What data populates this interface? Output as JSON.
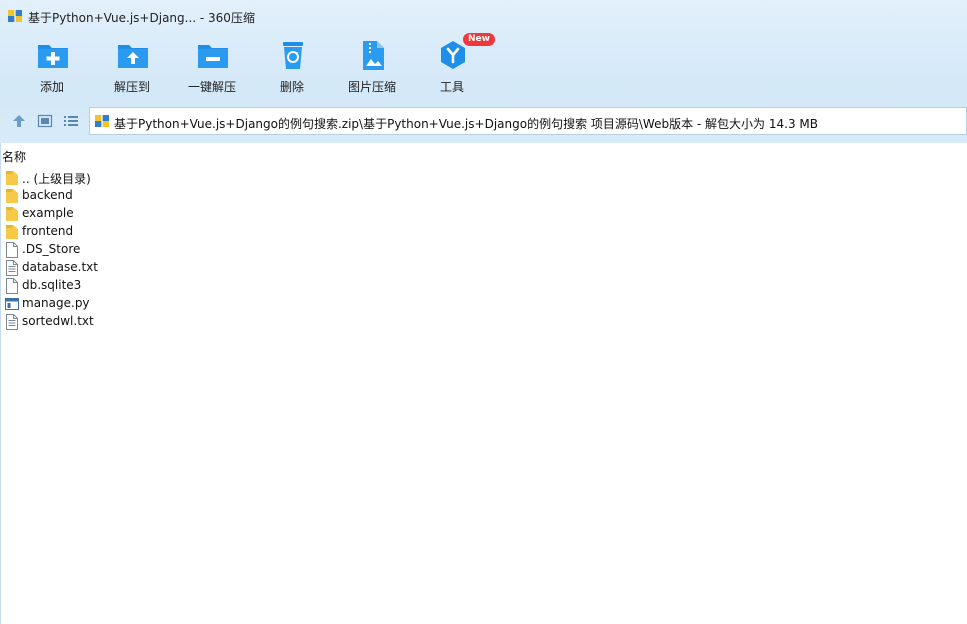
{
  "window": {
    "title": "基于Python+Vue.js+Djang... - 360压缩"
  },
  "toolbar": {
    "items": [
      {
        "label": "添加",
        "icon": "add-folder-icon"
      },
      {
        "label": "解压到",
        "icon": "extract-to-icon"
      },
      {
        "label": "一键解压",
        "icon": "one-click-extract-icon"
      },
      {
        "label": "删除",
        "icon": "recycle-bin-icon"
      },
      {
        "label": "图片压缩",
        "icon": "image-compress-icon"
      },
      {
        "label": "工具",
        "icon": "tools-icon",
        "badge": "New"
      }
    ]
  },
  "address": {
    "path": "基于Python+Vue.js+Django的例句搜索.zip\\基于Python+Vue.js+Django的例句搜索 项目源码\\Web版本 - 解包大小为 14.3 MB"
  },
  "list": {
    "column_header": "名称",
    "files": [
      {
        "name": ".. (上级目录)",
        "type": "folder"
      },
      {
        "name": "backend",
        "type": "folder"
      },
      {
        "name": "example",
        "type": "folder"
      },
      {
        "name": "frontend",
        "type": "folder"
      },
      {
        "name": ".DS_Store",
        "type": "file"
      },
      {
        "name": "database.txt",
        "type": "text"
      },
      {
        "name": "db.sqlite3",
        "type": "file"
      },
      {
        "name": "manage.py",
        "type": "python"
      },
      {
        "name": "sortedwl.txt",
        "type": "text"
      }
    ]
  },
  "colors": {
    "accent": "#1e8ee6",
    "chrome_bg": "#d6eaf9",
    "folder": "#f7c948",
    "badge": "#f0383a"
  }
}
